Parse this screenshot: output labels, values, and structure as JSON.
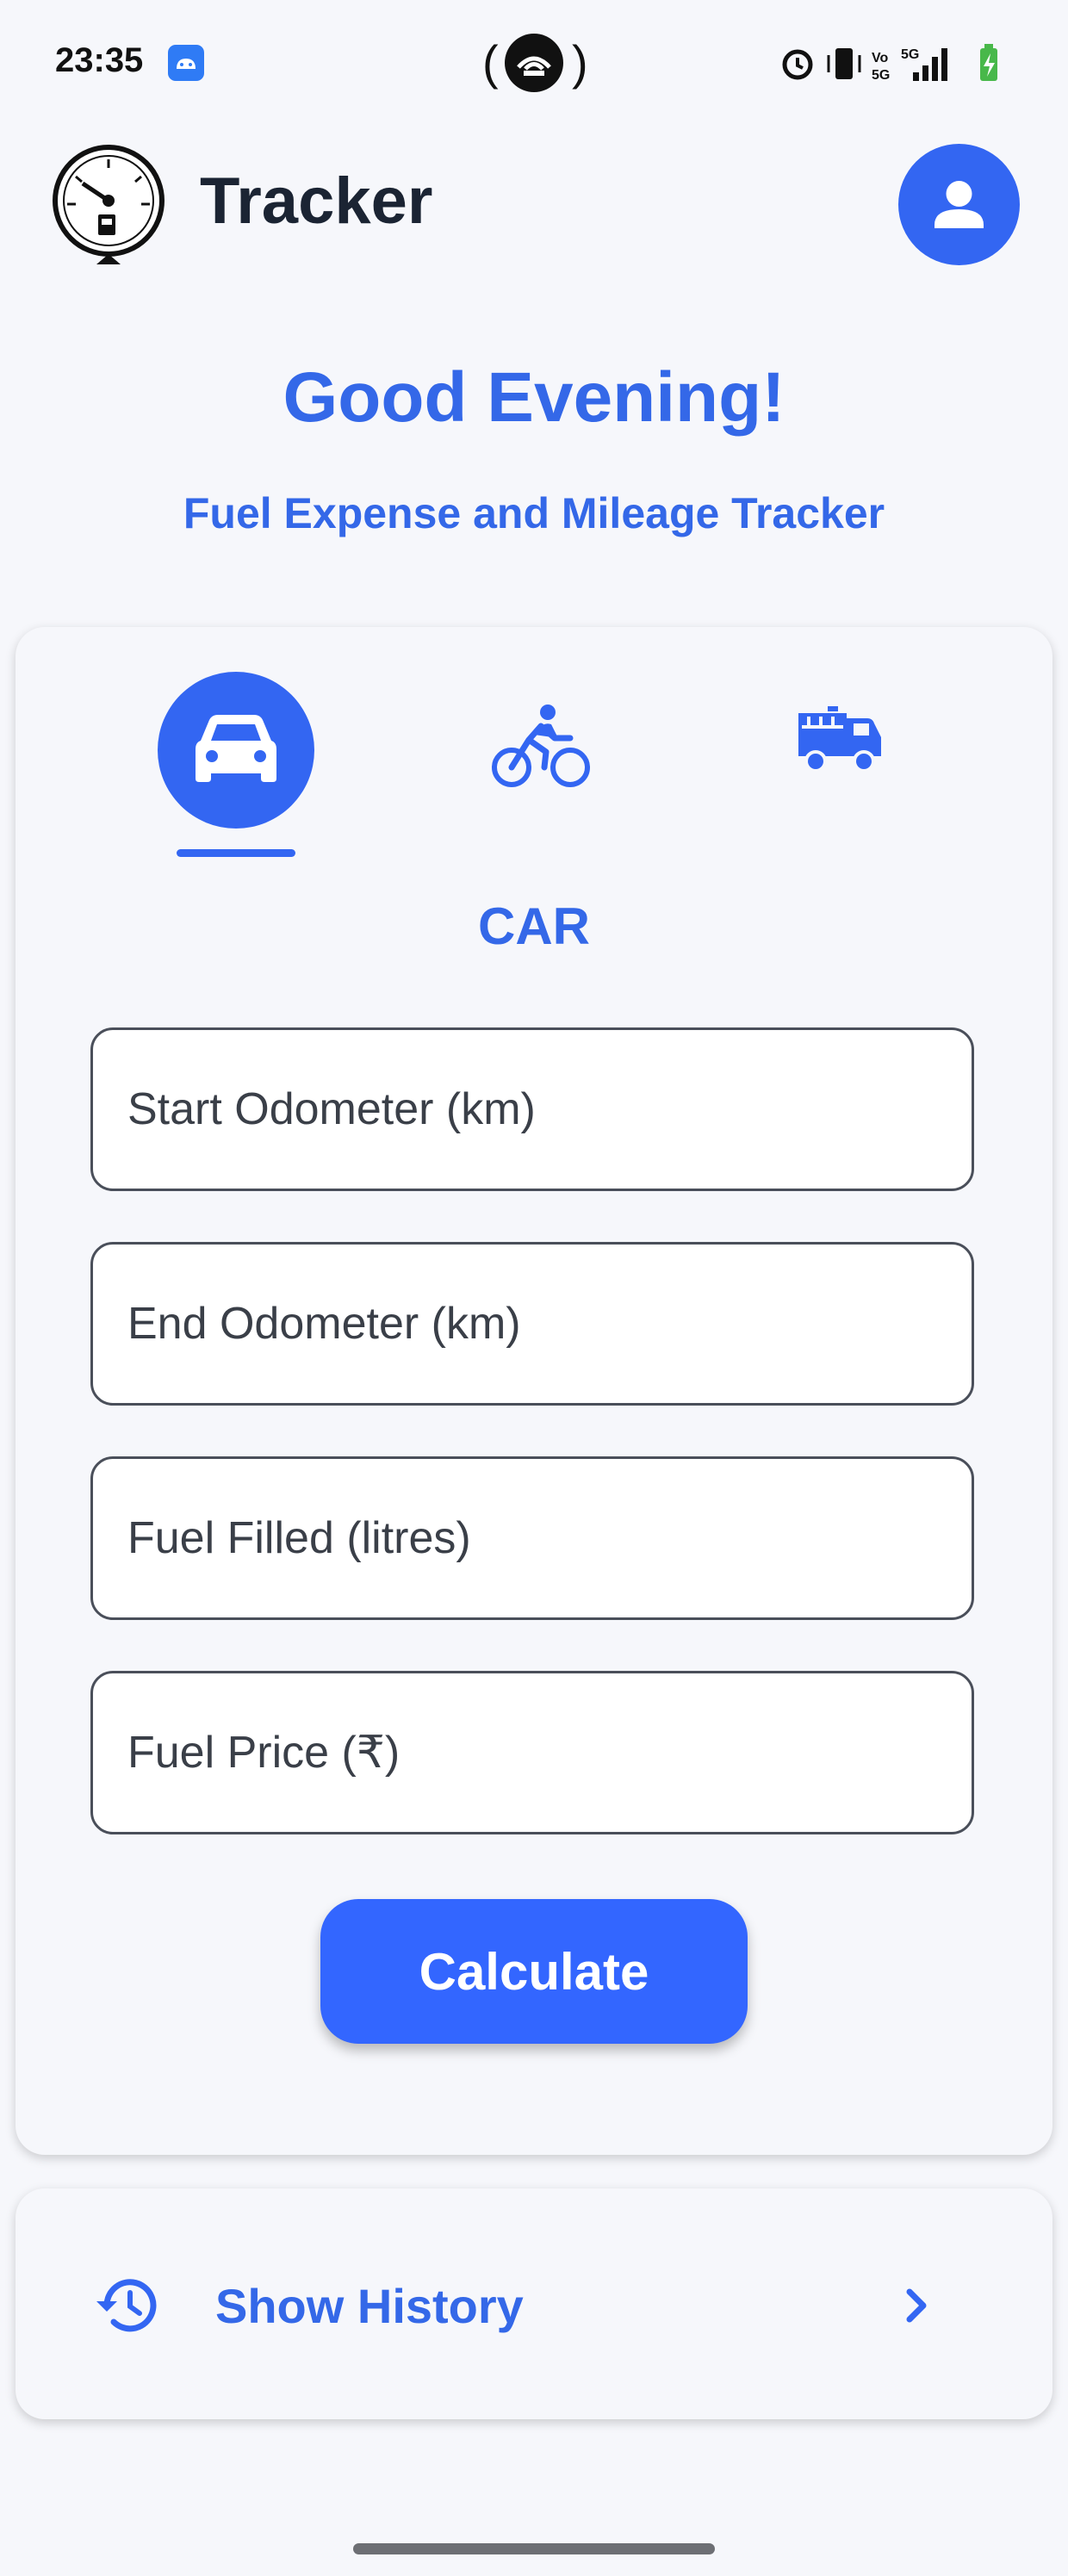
{
  "status_bar": {
    "time": "23:35"
  },
  "header": {
    "title": "Tracker"
  },
  "greeting": "Good Evening!",
  "subtitle": "Fuel Expense and Mileage Tracker",
  "vehicle": {
    "selected_label": "CAR"
  },
  "form": {
    "start_odometer_placeholder": "Start Odometer (km)",
    "end_odometer_placeholder": "End Odometer (km)",
    "fuel_filled_placeholder": "Fuel Filled (litres)",
    "fuel_price_placeholder": "Fuel Price (₹)",
    "calculate_label": "Calculate"
  },
  "history": {
    "label": "Show History"
  },
  "colors": {
    "accent": "#3366f2",
    "heading": "#3468e8",
    "background": "#f6f7fb"
  }
}
